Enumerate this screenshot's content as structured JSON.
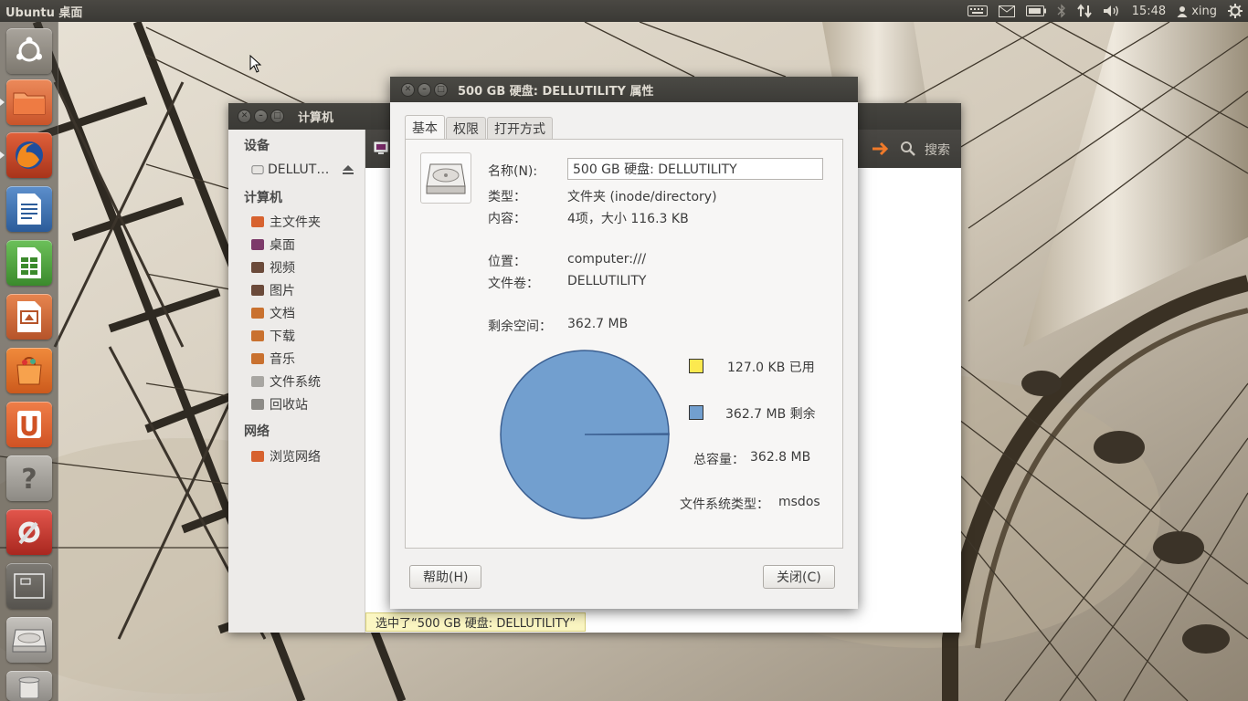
{
  "top_panel": {
    "title": "Ubuntu 桌面",
    "clock": "15:48",
    "user": "xing"
  },
  "launcher": {
    "items": [
      {
        "name": "dash-home-icon"
      },
      {
        "name": "files-icon"
      },
      {
        "name": "firefox-icon"
      },
      {
        "name": "libreoffice-writer-icon"
      },
      {
        "name": "libreoffice-calc-icon"
      },
      {
        "name": "libreoffice-impress-icon"
      },
      {
        "name": "software-center-icon"
      },
      {
        "name": "ubuntu-one-icon"
      },
      {
        "name": "help-icon"
      },
      {
        "name": "system-settings-icon"
      },
      {
        "name": "workspace-switcher-icon"
      },
      {
        "name": "drive-icon"
      },
      {
        "name": "trash-icon"
      }
    ]
  },
  "file_manager": {
    "title": "计算机",
    "search_label": "搜索",
    "sidebar": {
      "devices_header": "设备",
      "device_item": "DELLUT…",
      "computer_header": "计算机",
      "computer_items": [
        {
          "label": "主文件夹",
          "color": "#d7622f"
        },
        {
          "label": "桌面",
          "color": "#7d3a6a"
        },
        {
          "label": "视频",
          "color": "#6b4a3a"
        },
        {
          "label": "图片",
          "color": "#6b4a3a"
        },
        {
          "label": "文档",
          "color": "#c9712f"
        },
        {
          "label": "下载",
          "color": "#c9712f"
        },
        {
          "label": "音乐",
          "color": "#c9712f"
        },
        {
          "label": "文件系统",
          "color": "#a8a6a2"
        },
        {
          "label": "回收站",
          "color": "#8d8b87"
        }
      ],
      "network_header": "网络",
      "network_items": [
        {
          "label": "浏览网络",
          "color": "#d7622f"
        }
      ]
    },
    "status": "选中了“500 GB 硬盘: DELLUTILITY”"
  },
  "dialog": {
    "title": "500 GB 硬盘: DELLUTILITY 属性",
    "tabs": [
      "基本",
      "权限",
      "打开方式"
    ],
    "active_tab": "基本",
    "fields": {
      "name_label": "名称(N):",
      "name_value": "500 GB 硬盘: DELLUTILITY",
      "type_label": "类型：",
      "type_value": "文件夹 (inode/directory)",
      "contents_label": "内容：",
      "contents_value": "4项，大小 116.3 KB",
      "location_label": "位置：",
      "location_value": "computer:///",
      "volume_label": "文件卷：",
      "volume_value": "DELLUTILITY",
      "free_label": "剩余空间：",
      "free_value": "362.7 MB"
    },
    "usage": {
      "used_fraction": 0.00035,
      "used_color": "#fce94f",
      "free_color": "#729fcf",
      "used_label": "127.0 KB 已用",
      "free_label": "362.7 MB 剩余",
      "total_label": "总容量：",
      "total_value": "362.8 MB",
      "fstype_label": "文件系统类型：",
      "fstype_value": "msdos"
    },
    "help_button": "帮助(H)",
    "close_button": "关闭(C)"
  }
}
